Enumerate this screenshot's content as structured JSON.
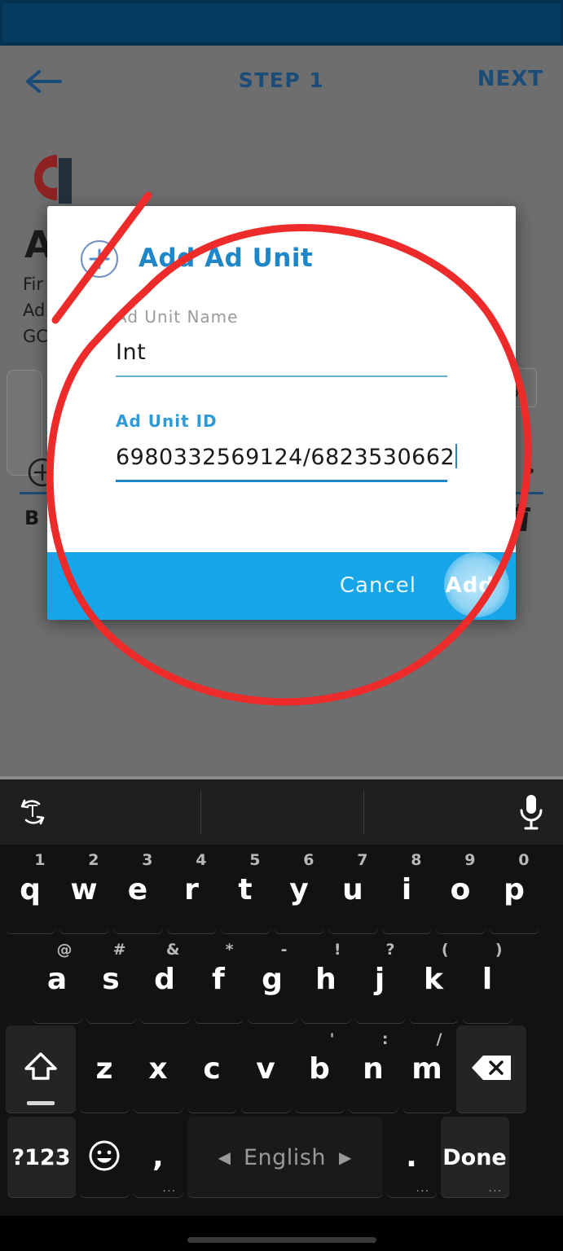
{
  "statusbar": {
    "background": "#043253"
  },
  "app": {
    "topbar": {
      "back_icon": "arrow-left-icon",
      "title": "STEP 1",
      "next_label": "NEXT",
      "color": "#1b4c78"
    },
    "background_content": {
      "logo_icon": "app-logo-icon",
      "heading": "A",
      "paragraph": "Fir                                                                    e.\nAd                                                                    b\nGC",
      "chip_label": "ng",
      "add_row": {
        "plus_icon": "plus-circle-icon",
        "chevron_icon": "chevron-right-icon"
      },
      "banner_row": {
        "label": "B",
        "trash_icon": "trash-icon"
      }
    }
  },
  "dialog": {
    "plus_icon": "plus-circle-icon",
    "title": "Add Ad Unit",
    "title_color": "#1f86c8",
    "fields": [
      {
        "label": "Ad Unit Name",
        "value": "Int",
        "focused": false
      },
      {
        "label": "Ad Unit ID",
        "value": "6980332569124/6823530662",
        "focused": true
      }
    ],
    "footer": {
      "background": "#16a5e8",
      "cancel_label": "Cancel",
      "add_label": "Add",
      "add_pressed": true
    }
  },
  "annotation": {
    "color": "#ee2b2b",
    "shapes": [
      "ellipse-circle",
      "diagonal-stroke"
    ]
  },
  "keyboard": {
    "suggestion_bar": {
      "translate_icon": "translate-icon",
      "mic_icon": "microphone-icon"
    },
    "rows": [
      {
        "keys": [
          {
            "main": "q",
            "sup": "1"
          },
          {
            "main": "w",
            "sup": "2"
          },
          {
            "main": "e",
            "sup": "3"
          },
          {
            "main": "r",
            "sup": "4"
          },
          {
            "main": "t",
            "sup": "5"
          },
          {
            "main": "y",
            "sup": "6"
          },
          {
            "main": "u",
            "sup": "7"
          },
          {
            "main": "i",
            "sup": "8"
          },
          {
            "main": "o",
            "sup": "9"
          },
          {
            "main": "p",
            "sup": "0"
          }
        ]
      },
      {
        "keys": [
          {
            "main": "a",
            "sup": "@"
          },
          {
            "main": "s",
            "sup": "#"
          },
          {
            "main": "d",
            "sup": "&"
          },
          {
            "main": "f",
            "sup": "*"
          },
          {
            "main": "g",
            "sup": "-"
          },
          {
            "main": "h",
            "sup": "!"
          },
          {
            "main": "j",
            "sup": "?"
          },
          {
            "main": "k",
            "sup": "("
          },
          {
            "main": "l",
            "sup": ")"
          }
        ]
      },
      {
        "keys": [
          {
            "main": "",
            "icon": "shift-icon"
          },
          {
            "main": "z",
            "sup": ""
          },
          {
            "main": "x",
            "sup": ""
          },
          {
            "main": "c",
            "sup": ""
          },
          {
            "main": "v",
            "sup": ""
          },
          {
            "main": "b",
            "sup": "'"
          },
          {
            "main": "n",
            "sup": ":"
          },
          {
            "main": "m",
            "sup": "/"
          },
          {
            "main": "",
            "icon": "backspace-icon"
          }
        ]
      },
      {
        "keys": [
          {
            "main": "?123"
          },
          {
            "main": "",
            "icon": "emoji-icon"
          },
          {
            "main": ",",
            "dots": "..."
          },
          {
            "main": "English",
            "icon": "space-key"
          },
          {
            "main": ".",
            "dots": "..."
          },
          {
            "main": "Done",
            "dots": "..."
          }
        ]
      }
    ]
  },
  "gesture_bar": {
    "present": true
  }
}
